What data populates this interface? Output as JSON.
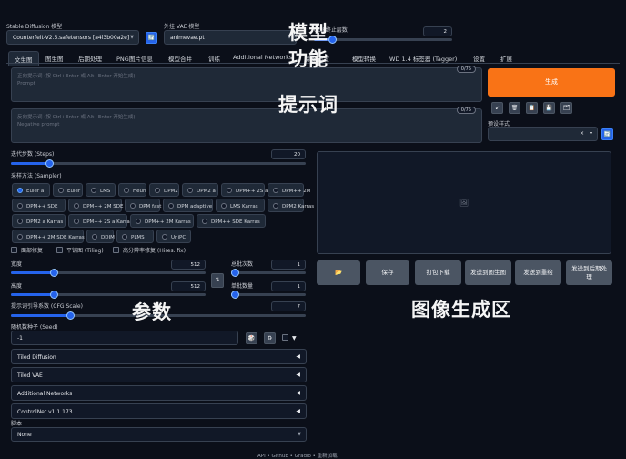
{
  "top": {
    "model_label": "Stable Diffusion 模型",
    "model_value": "Counterfeit-V2.5.safetensors [a4l3b00a2e]",
    "vae_label": "外挂 VAE 模型",
    "vae_value": "animevae.pt",
    "clip_label": "CLIP终止层数",
    "clip_value": "2"
  },
  "tabs": [
    "文生图",
    "图生图",
    "后期处理",
    "PNG图片信息",
    "模型合并",
    "训练",
    "Additional Networks",
    "系统设置",
    "模型转换",
    "WD 1.4 标签器 (Tagger)",
    "设置",
    "扩展"
  ],
  "prompt": {
    "placeholder_line1": "正向提示词 (按 Ctrl+Enter 或 Alt+Enter 开始生成)",
    "placeholder_line2": "Prompt",
    "counter": "0/75"
  },
  "negative": {
    "placeholder_line1": "反向提示词 (按 Ctrl+Enter 或 Alt+Enter 开始生成)",
    "placeholder_line2": "Negative prompt",
    "counter": "0/75"
  },
  "generate_label": "生成",
  "styles": {
    "label": "预设样式",
    "clear": "×",
    "caret": "▾"
  },
  "steps": {
    "label": "迭代步数 (Steps)",
    "value": "20",
    "fraction": 0.13
  },
  "sampler": {
    "label": "采样方法 (Sampler)",
    "selected": "Euler a",
    "options": [
      "Euler a",
      "Euler",
      "LMS",
      "Heun",
      "DPM2",
      "DPM2 a",
      "DPM++ 2S a",
      "DPM++ 2M",
      "DPM++ SDE",
      "DPM++ 2M SDE",
      "DPM fast",
      "DPM adaptive",
      "LMS Karras",
      "DPM2 Karras",
      "DPM2 a Karras",
      "DPM++ 2S a Karras",
      "DPM++ 2M Karras",
      "DPM++ SDE Karras",
      "DPM++ 2M SDE Karras",
      "DDIM",
      "PLMS",
      "UniPC"
    ]
  },
  "checks": {
    "restore_faces": "面部修复",
    "tiling": "平铺图 (Tiling)",
    "hires": "高分辨率修复 (Hires. fix)"
  },
  "width": {
    "label": "宽度",
    "value": "512",
    "fraction": 0.22
  },
  "height": {
    "label": "高度",
    "value": "512",
    "fraction": 0.22
  },
  "swap_icon": "⇅",
  "batch_count": {
    "label": "总批次数",
    "value": "1",
    "fraction": 0.01
  },
  "batch_size": {
    "label": "单批数量",
    "value": "1",
    "fraction": 0.01
  },
  "cfg": {
    "label": "提示词引导系数 (CFG Scale)",
    "value": "7",
    "fraction": 0.2
  },
  "seed": {
    "label": "随机数种子 (Seed)",
    "value": "-1",
    "dice": "🎲",
    "recycle": "♻",
    "more": "▼"
  },
  "accordions": [
    "Tiled Diffusion",
    "Tiled VAE",
    "Additional Networks",
    "ControlNet v1.1.173"
  ],
  "accordion_arrow": "◀",
  "script": {
    "label": "脚本",
    "value": "None"
  },
  "gallery_buttons": {
    "folder": "📂",
    "save": "保存",
    "zip": "打包下载",
    "to_img2img": "发送到图生图",
    "to_inpaint": "发送到重绘",
    "to_extras": "发送到后期处理"
  },
  "image_placeholder": "🖼",
  "tool_icons": [
    "↙",
    "🗑",
    "📋",
    "💾",
    "🗂"
  ],
  "refresh_icon": "🔄",
  "footer": "API  •  Github  •  Gradio  •  重新加载",
  "overlays": {
    "model": "模型",
    "function": "功能",
    "prompt": "提示词",
    "params": "参数",
    "image_area": "图像生成区"
  },
  "colors": {
    "accent": "#2563eb",
    "generate": "#f97316",
    "background": "#0b0f19"
  }
}
